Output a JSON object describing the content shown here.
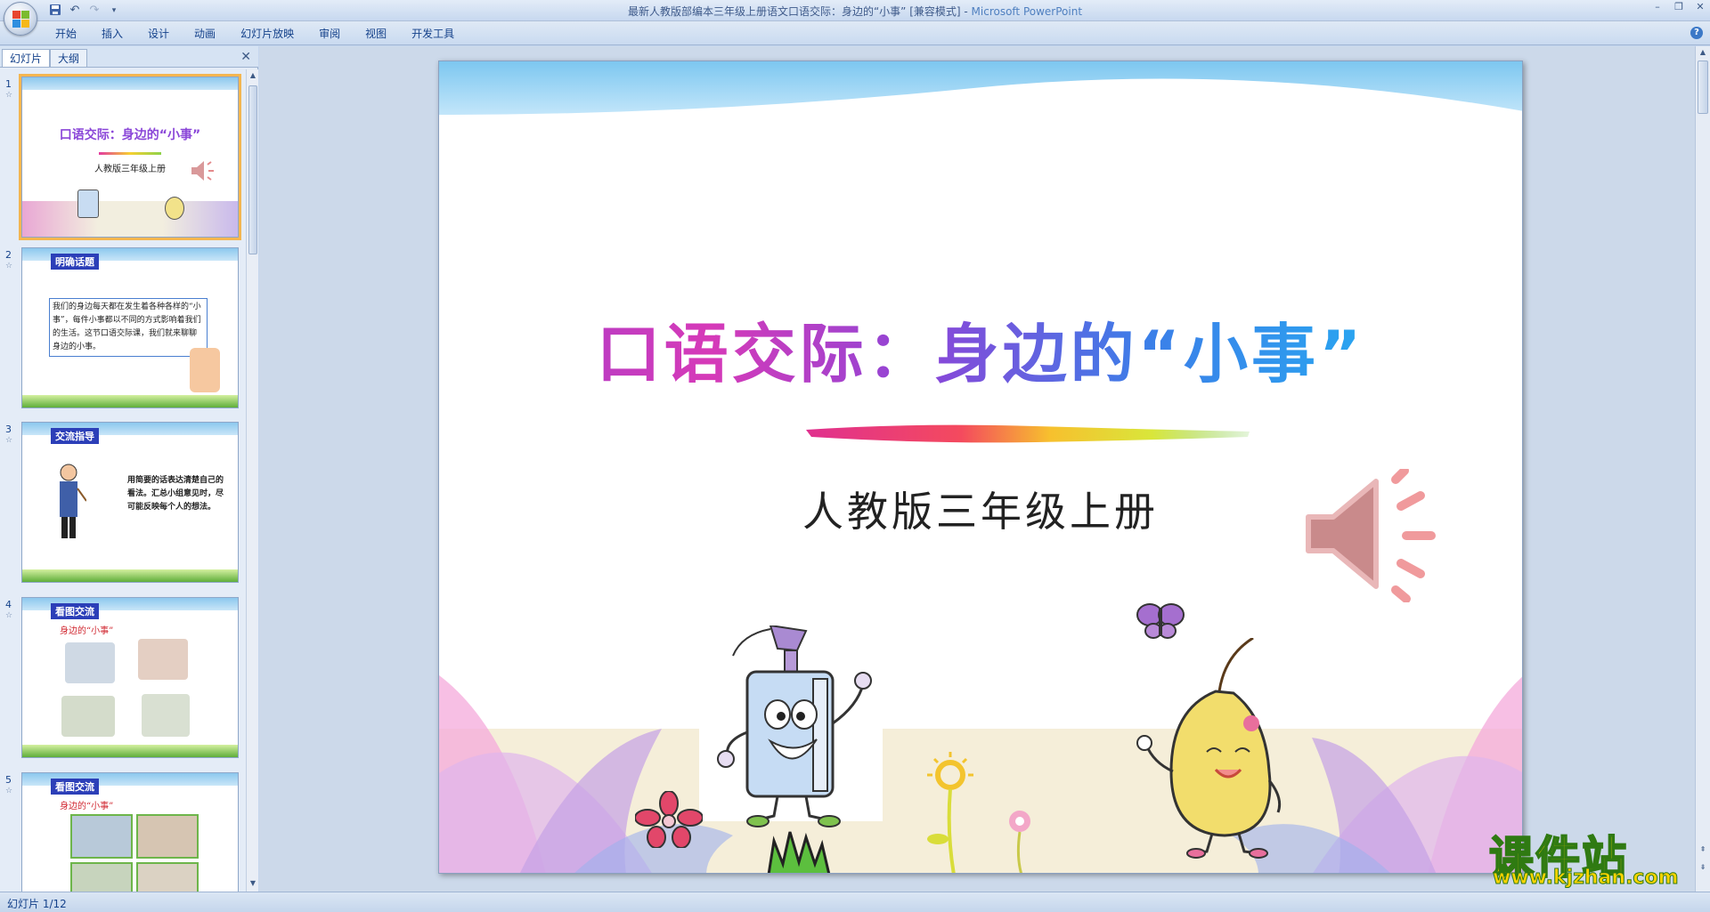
{
  "window": {
    "title": "最新人教版部编本三年级上册语文口语交际：身边的“小事” [兼容模式] - ",
    "app_name": "Microsoft PowerPoint"
  },
  "ribbon": {
    "tabs": [
      "开始",
      "插入",
      "设计",
      "动画",
      "幻灯片放映",
      "审阅",
      "视图",
      "开发工具"
    ]
  },
  "panel": {
    "tabs": [
      "幻灯片",
      "大纲"
    ]
  },
  "thumbnails": [
    {
      "number": "1",
      "title": "口语交际：身边的“小事”",
      "subtitle": "人教版三年级上册"
    },
    {
      "number": "2",
      "badge": "明确话题",
      "text": "我们的身边每天都在发生着各种各样的“小事”，每件小事都以不同的方式影响着我们的生活。这节口语交际课，我们就来聊聊身边的小事。"
    },
    {
      "number": "3",
      "badge": "交流指导",
      "text": "用简要的话表达清楚自己的看法。汇总小组意见时，尽可能反映每个人的想法。"
    },
    {
      "number": "4",
      "badge": "看图交流",
      "red": "身边的“小事”"
    },
    {
      "number": "5",
      "badge": "看图交流",
      "red": "身边的“小事”"
    }
  ],
  "slide": {
    "title": "口语交际：身边的“小事”",
    "subtitle": "人教版三年级上册"
  },
  "status": {
    "text": "幻灯片 1/12"
  },
  "watermark": {
    "main": "课件站",
    "url": "www.kjzhan.com"
  }
}
